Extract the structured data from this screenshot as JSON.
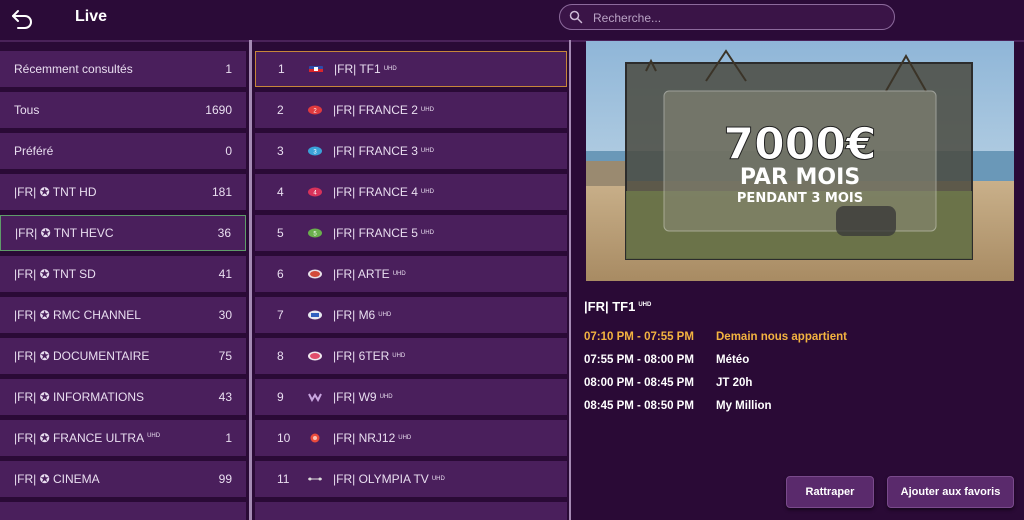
{
  "header": {
    "title": "Live",
    "search_placeholder": "Recherche..."
  },
  "categories": [
    {
      "label": "Récemment consultés",
      "count": "1"
    },
    {
      "label": "Tous",
      "count": "1690"
    },
    {
      "label": "Préféré",
      "count": "0"
    },
    {
      "label": "|FR| ✪ TNT HD",
      "count": "181"
    },
    {
      "label": "|FR| ✪ TNT HEVC",
      "count": "36"
    },
    {
      "label": "|FR| ✪ TNT SD",
      "count": "41"
    },
    {
      "label": "|FR| ✪ RMC CHANNEL",
      "count": "30"
    },
    {
      "label": "|FR| ✪ DOCUMENTAIRE",
      "count": "75"
    },
    {
      "label": "|FR| ✪ INFORMATIONS",
      "count": "43"
    },
    {
      "label": "|FR| ✪ FRANCE ULTRA",
      "sup": "UHD",
      "count": "1"
    },
    {
      "label": "|FR| ✪ CINEMA",
      "count": "99"
    }
  ],
  "channels": [
    {
      "num": "1",
      "name": "|FR| TF1",
      "sup": "UHD"
    },
    {
      "num": "2",
      "name": "|FR| FRANCE 2",
      "sup": "UHD"
    },
    {
      "num": "3",
      "name": "|FR| FRANCE 3",
      "sup": "UHD"
    },
    {
      "num": "4",
      "name": "|FR| FRANCE 4",
      "sup": "UHD"
    },
    {
      "num": "5",
      "name": "|FR| FRANCE 5",
      "sup": "UHD"
    },
    {
      "num": "6",
      "name": "|FR| ARTE",
      "sup": "UHD"
    },
    {
      "num": "7",
      "name": "|FR| M6",
      "sup": "UHD"
    },
    {
      "num": "8",
      "name": "|FR| 6TER",
      "sup": "UHD"
    },
    {
      "num": "9",
      "name": "|FR| W9",
      "sup": "UHD"
    },
    {
      "num": "10",
      "name": "|FR| NRJ12",
      "sup": "UHD"
    },
    {
      "num": "11",
      "name": "|FR| OLYMPIA TV",
      "sup": "UHD"
    }
  ],
  "preview": {
    "line1": "7000€",
    "line2": "PAR MOIS",
    "line3": "PENDANT 3 MOIS"
  },
  "info": {
    "channel": "|FR| TF1",
    "sup": "UHD"
  },
  "epg": [
    {
      "time": "07:10 PM - 07:55 PM",
      "title": "Demain nous appartient"
    },
    {
      "time": "07:55 PM - 08:00 PM",
      "title": "Météo"
    },
    {
      "time": "08:00 PM - 08:45 PM",
      "title": "JT 20h"
    },
    {
      "time": "08:45 PM - 08:50 PM",
      "title": "My Million"
    }
  ],
  "buttons": {
    "catchup": "Rattraper",
    "favorite": "Ajouter aux favoris"
  },
  "colors": {
    "background": "#2a0a36",
    "item": "#4a1f5c",
    "selected_category_border": "#5f9c6a",
    "selected_channel_border": "#c7863a",
    "current_program": "#f3b340"
  }
}
